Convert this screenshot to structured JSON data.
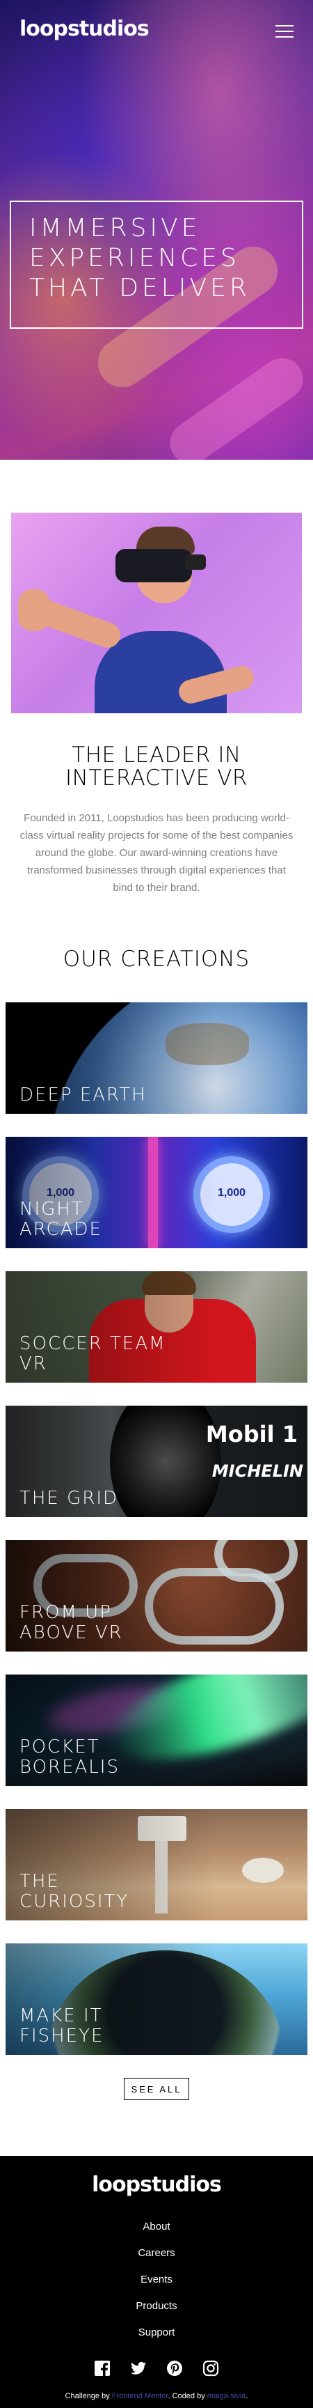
{
  "header": {
    "logo": "loopstudios",
    "menu_icon": "hamburger-menu-icon"
  },
  "hero": {
    "title": "IMMERSIVE\nEXPERIENCES\nTHAT DELIVER"
  },
  "about": {
    "title": "THE LEADER IN\nINTERACTIVE VR",
    "text": "Founded in 2011, Loopstudios has been producing world-class virtual reality projects for some of the best companies around the globe. Our award-winning creations have transformed businesses through digital experiences that bind to their brand."
  },
  "creations": {
    "title": "OUR CREATIONS",
    "items": [
      {
        "label": "DEEP EARTH"
      },
      {
        "label": "NIGHT ARCADE"
      },
      {
        "label": "SOCCER TEAM VR"
      },
      {
        "label": "THE GRID"
      },
      {
        "label": "FROM UP ABOVE VR"
      },
      {
        "label": "POCKET BOREALIS"
      },
      {
        "label": "THE CURIOSITY"
      },
      {
        "label": "MAKE IT FISHEYE"
      }
    ],
    "see_all": "SEE ALL"
  },
  "decor": {
    "arcade_ring_text": "1,000",
    "grid_sponsor_1": "Mobil 1",
    "grid_sponsor_2": "MICHELIN"
  },
  "footer": {
    "logo": "loopstudios",
    "nav": [
      "About",
      "Careers",
      "Events",
      "Products",
      "Support"
    ],
    "socials": [
      "facebook-icon",
      "twitter-icon",
      "pinterest-icon",
      "instagram-icon"
    ],
    "attribution_prefix": "Challenge by",
    "attribution_link_1": "Frontend Mentor",
    "attribution_middle": ". Coded by",
    "attribution_link_2": "maiga-sivia",
    "attribution_suffix": "."
  }
}
